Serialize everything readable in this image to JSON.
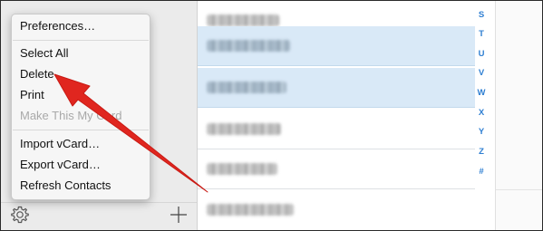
{
  "menu": {
    "items": [
      {
        "label": "Preferences…",
        "enabled": true
      },
      {
        "label": "Select All",
        "enabled": true
      },
      {
        "label": "Delete",
        "enabled": true
      },
      {
        "label": "Print",
        "enabled": true
      },
      {
        "label": "Make This My Card",
        "enabled": false
      },
      {
        "label": "Import vCard…",
        "enabled": true
      },
      {
        "label": "Export vCard…",
        "enabled": true
      },
      {
        "label": "Refresh Contacts",
        "enabled": true
      }
    ]
  },
  "index_letters": [
    "S",
    "T",
    "U",
    "V",
    "W",
    "X",
    "Y",
    "Z",
    "#"
  ],
  "contacts": {
    "selected_rows": [
      1,
      2
    ]
  },
  "icons": {
    "settings": "gear-icon",
    "add": "plus-icon",
    "annotation": "red-arrow-icon"
  },
  "colors": {
    "selection": "#d9e9f7",
    "index_letter": "#2f7fd2",
    "arrow": "#e0261f"
  }
}
